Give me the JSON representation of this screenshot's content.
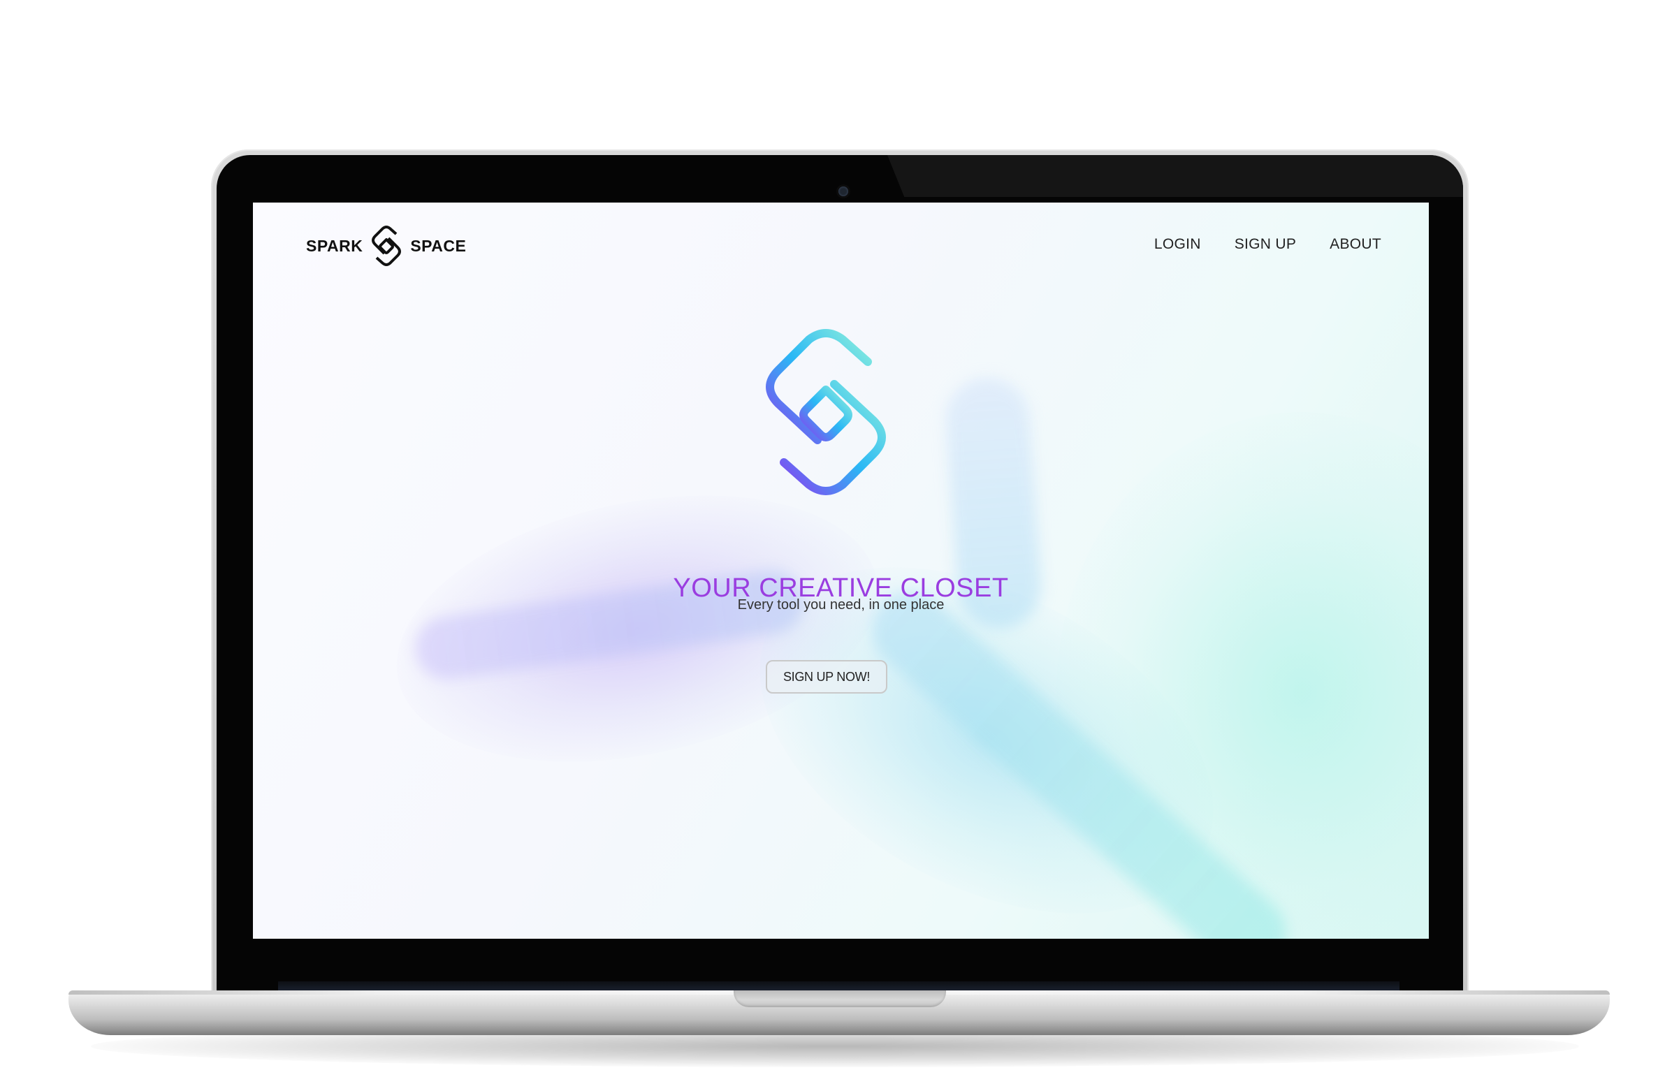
{
  "brand": {
    "left_word": "SPARK",
    "right_word": "SPACE",
    "logo_icon": "spark-space-s-logo-icon"
  },
  "nav": {
    "items": [
      {
        "label": "LOGIN"
      },
      {
        "label": "SIGN UP"
      },
      {
        "label": "ABOUT"
      }
    ]
  },
  "hero": {
    "logo_icon": "gradient-s-logo-icon",
    "title": "YOUR CREATIVE CLOSET",
    "subtitle": "Every tool you need, in one place",
    "cta_label": "SIGN UP NOW!"
  },
  "colors": {
    "accent": "#9a3de0",
    "gradient_start": "#8a3ef0",
    "gradient_mid": "#2ab8f5",
    "gradient_end": "#8ff0dc"
  }
}
